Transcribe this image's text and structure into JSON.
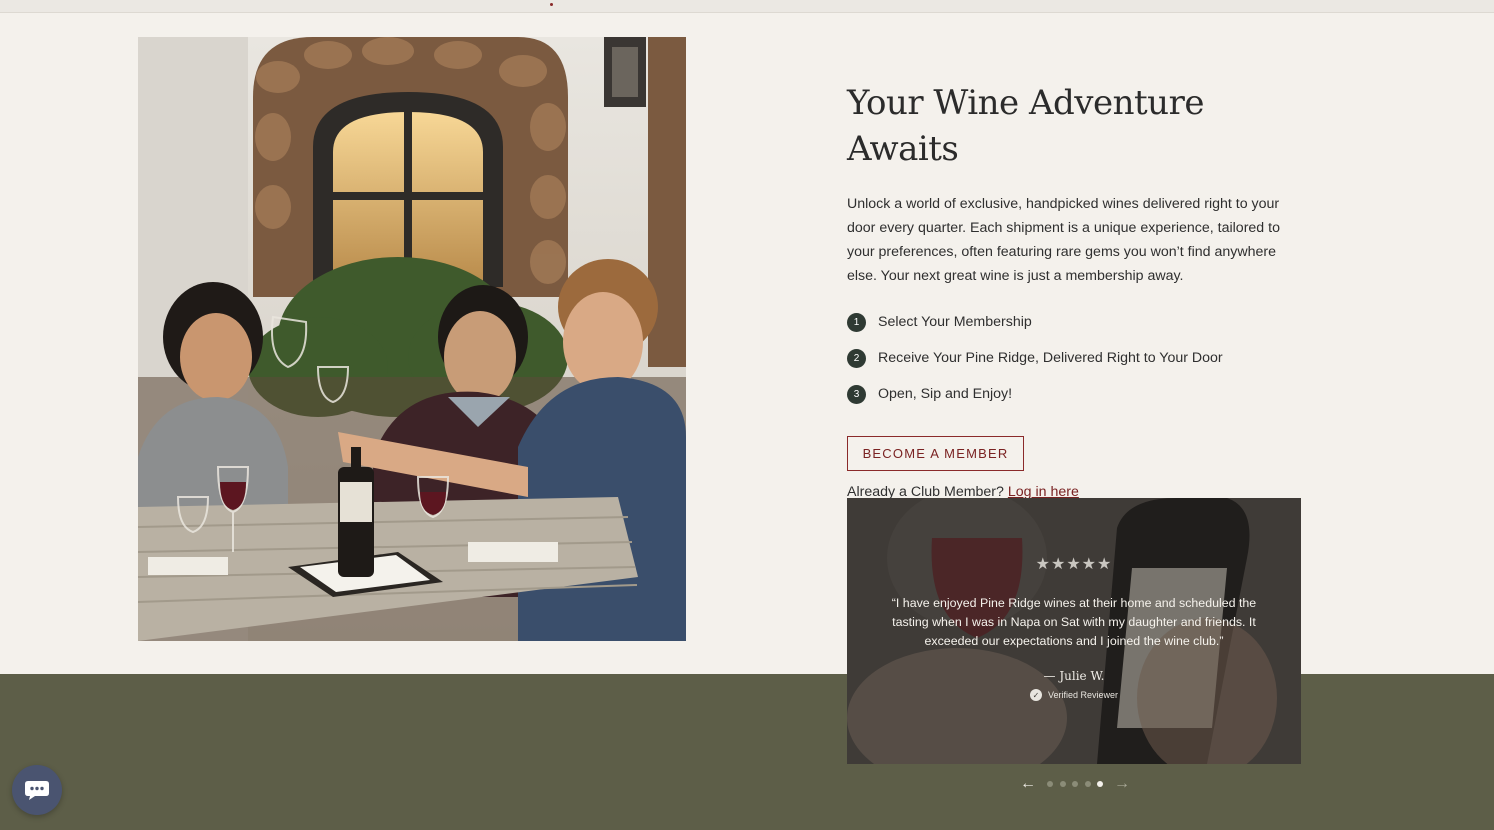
{
  "hero": {
    "title": "Your Wine Adventure Awaits",
    "description": "Unlock a world of exclusive, handpicked wines delivered right to your door every quarter. Each shipment is a unique experience, tailored to your preferences, often featuring rare gems you won’t find anywhere else. Your next great wine is just a membership away.",
    "steps": [
      {
        "number": "1",
        "label": "Select Your Membership"
      },
      {
        "number": "2",
        "label": "Receive Your Pine Ridge, Delivered Right to Your Door"
      },
      {
        "number": "3",
        "label": "Open, Sip and Enjoy!"
      }
    ],
    "cta_label": "BECOME A MEMBER",
    "member_prompt": "Already a Club Member?",
    "login_link": "Log in here"
  },
  "review": {
    "stars": "★★★★★",
    "rating": 5,
    "quote": "“I have enjoyed Pine Ridge wines at their home and scheduled the tasting when I was in Napa on Sat with my daughter and friends. It exceeded our expectations and I joined the wine club.”",
    "reviewer": "— Julie W.",
    "verified_label": "Verified Reviewer"
  },
  "carousel": {
    "prev_icon": "arrow-left-icon",
    "next_icon": "arrow-right-icon",
    "slide_count": 5,
    "active_index": 4,
    "prev_arrow": "←",
    "next_arrow": "→"
  },
  "chat": {
    "icon": "chat-bubble-icon"
  },
  "colors": {
    "background": "#f4f1ec",
    "band": "#5d5e48",
    "accent": "#7a2222",
    "step_badge": "#2f3a33",
    "chat": "#4a5470"
  }
}
